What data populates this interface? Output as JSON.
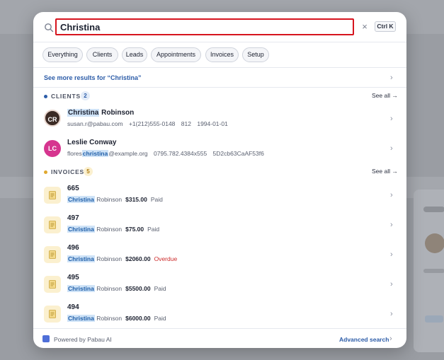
{
  "search": {
    "value": "Christina",
    "clear_label": "×",
    "shortcut": "Ctrl K"
  },
  "filters": [
    "Everything",
    "Clients",
    "Leads",
    "Appointments",
    "Invoices",
    "Setup"
  ],
  "see_more": "See more results for “Christina”",
  "clients": {
    "label": "CLIENTS",
    "count": "2",
    "see_all": "See all →",
    "dot_color": "#2c5ca8",
    "items": [
      {
        "initials": "CR",
        "name_highlight": "Christina",
        "name_rest": " Robinson",
        "email": "susan.r@pabau.com",
        "phone": "+1(212)555-0148",
        "extra": "812",
        "date": "1994-01-01"
      },
      {
        "initials": "LC",
        "name": "Leslie Conway",
        "email_pre": "flores",
        "email_hl": "christina",
        "email_post": "@example.org",
        "phone": "0795.782.4384x555",
        "extra": "5D2cb63CaAF53f6"
      }
    ]
  },
  "invoices": {
    "label": "INVOICES",
    "count": "5",
    "see_all": "See all →",
    "dot_color": "#e0a82e",
    "items": [
      {
        "number": "665",
        "first": "Christina",
        "last": " Robinson",
        "amount": "$315.00",
        "status": "Paid"
      },
      {
        "number": "497",
        "first": "Christina",
        "last": " Robinson",
        "amount": "$75.00",
        "status": "Paid"
      },
      {
        "number": "496",
        "first": "Christina",
        "last": " Robinson",
        "amount": "$2060.00",
        "status": "Overdue"
      },
      {
        "number": "495",
        "first": "Christina",
        "last": " Robinson",
        "amount": "$5500.00",
        "status": "Paid"
      },
      {
        "number": "494",
        "first": "Christina",
        "last": " Robinson",
        "amount": "$6000.00",
        "status": "Paid"
      }
    ]
  },
  "footer": {
    "powered": "Powered by Pabau AI",
    "advanced": "Advanced search"
  },
  "colors": {
    "accent": "#2c5ca8",
    "highlight_bg": "#cfe3f7",
    "overdue": "#cc2b2b",
    "search_border": "#d6141e"
  }
}
